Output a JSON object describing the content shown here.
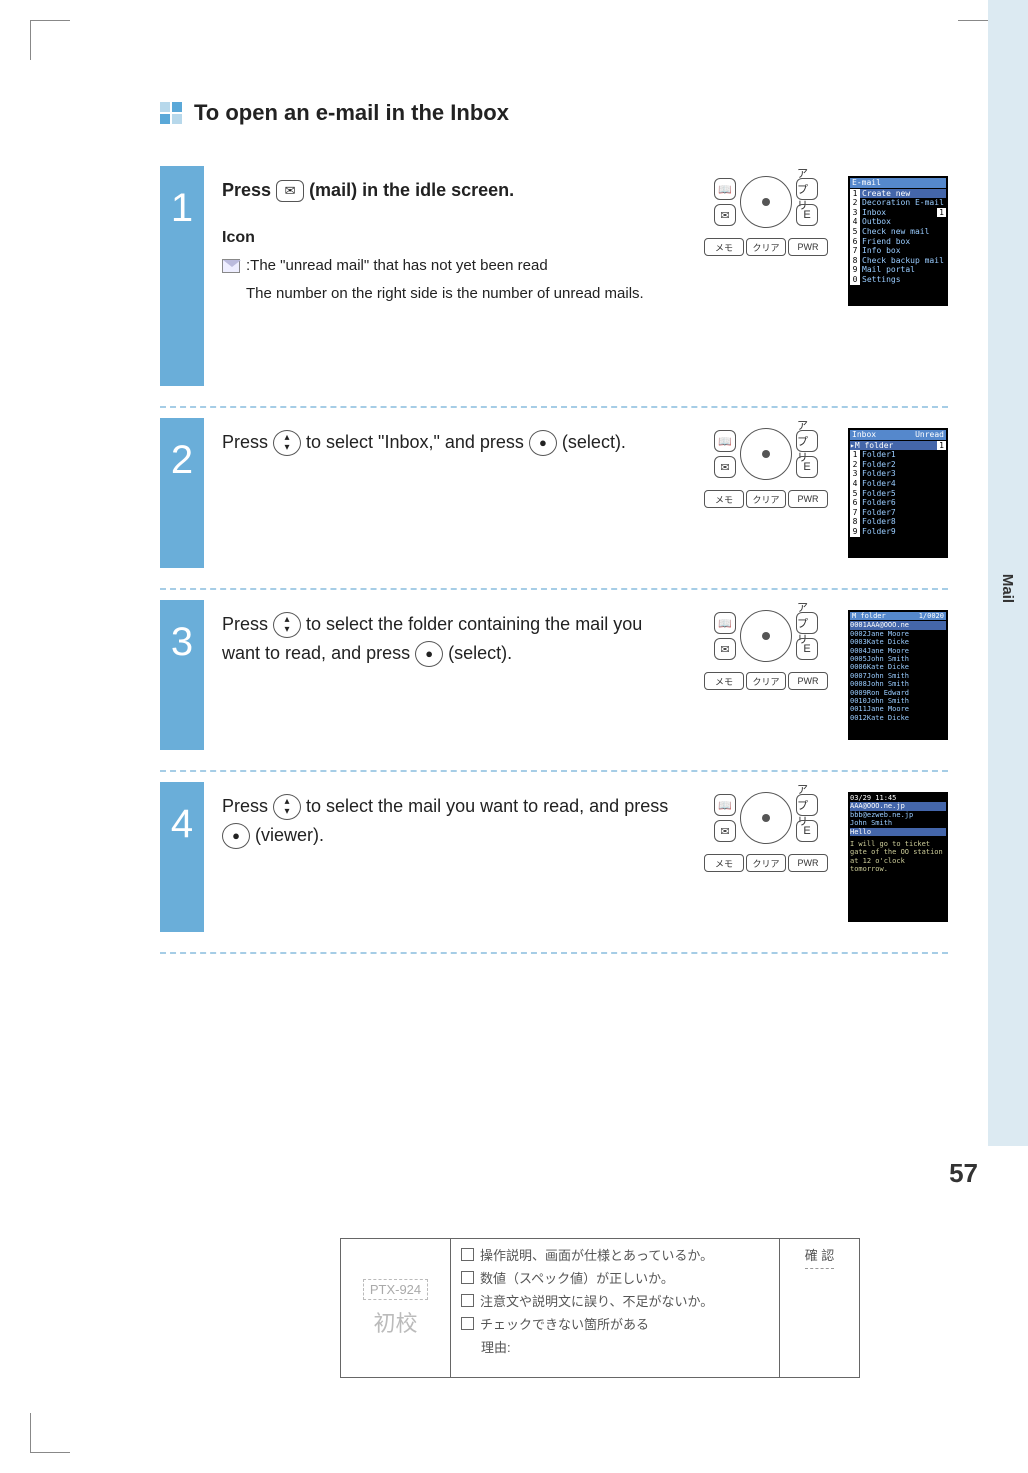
{
  "heading": "To open an e-mail in the Inbox",
  "sideTab": "Mail",
  "pageNumber": "57",
  "steps": [
    {
      "num": "1",
      "text_before": "Press ",
      "key1": "✉",
      "text_after": " (mail) in the idle screen.",
      "iconSection": {
        "label": "Icon",
        "desc1": ":The \"unread mail\" that has not yet been read",
        "desc2": "The number on the right side is the number of unread mails."
      },
      "screen": {
        "title": "E-mail",
        "items": [
          "Create new",
          "Decoration E-mail",
          "Inbox",
          "Outbox",
          "Check new mail",
          "Friend box",
          "Info box",
          "Check backup mail",
          "Mail portal",
          "Settings"
        ],
        "badge": "1"
      }
    },
    {
      "num": "2",
      "text": "Press ⬍ to select \"Inbox,\" and press ● (select).",
      "screen": {
        "title": "Inbox",
        "right": "Unread",
        "sub": "M folder",
        "badge": "1",
        "items": [
          "Folder1",
          "Folder2",
          "Folder3",
          "Folder4",
          "Folder5",
          "Folder6",
          "Folder7",
          "Folder8",
          "Folder9"
        ]
      }
    },
    {
      "num": "3",
      "text": "Press ⬍ to select the folder containing the mail you want to read, and press ● (select).",
      "screen": {
        "title": "M folder",
        "count": "1/0020",
        "items": [
          {
            "n": "0001",
            "s": "AAA@OOO.ne"
          },
          {
            "n": "0002",
            "s": "Jane Moore"
          },
          {
            "n": "0003",
            "s": "Kate Dicke"
          },
          {
            "n": "0004",
            "s": "Jane Moore"
          },
          {
            "n": "0005",
            "s": "John Smith"
          },
          {
            "n": "0006",
            "s": "Kate Dicke"
          },
          {
            "n": "0007",
            "s": "John Smith"
          },
          {
            "n": "0008",
            "s": "John Smith"
          },
          {
            "n": "0009",
            "s": "Ron Edward"
          },
          {
            "n": "0010",
            "s": "John Smith"
          },
          {
            "n": "0011",
            "s": "Jane Moore"
          },
          {
            "n": "0012",
            "s": "Kate Dicke"
          }
        ]
      }
    },
    {
      "num": "4",
      "text": "Press ⬍ to select the mail you want to read, and press ● (viewer).",
      "screen": {
        "date": "03/29 11:45",
        "from": "AAA@OOO.ne.jp",
        "to": "bbb@ezweb.ne.jp",
        "name": "John Smith",
        "subj": "Hello",
        "body": "I will go to ticket gate of the OO station at 12 o'clock tomorrow."
      }
    }
  ],
  "keypad": {
    "left": "📖",
    "right": "アプリ",
    "bl": "✉",
    "br": "E",
    "soft1": "メモ",
    "soft2": "クリア",
    "soft3": "PWR"
  },
  "review": {
    "code": "PTX-924",
    "proof": "初校",
    "items": [
      "操作説明、画面が仕様とあっているか。",
      "数値（スペック値）が正しいか。",
      "注意文や説明文に誤り、不足がないか。",
      "チェックできない箇所がある"
    ],
    "reason": "理由:",
    "confirm": "確 認"
  }
}
